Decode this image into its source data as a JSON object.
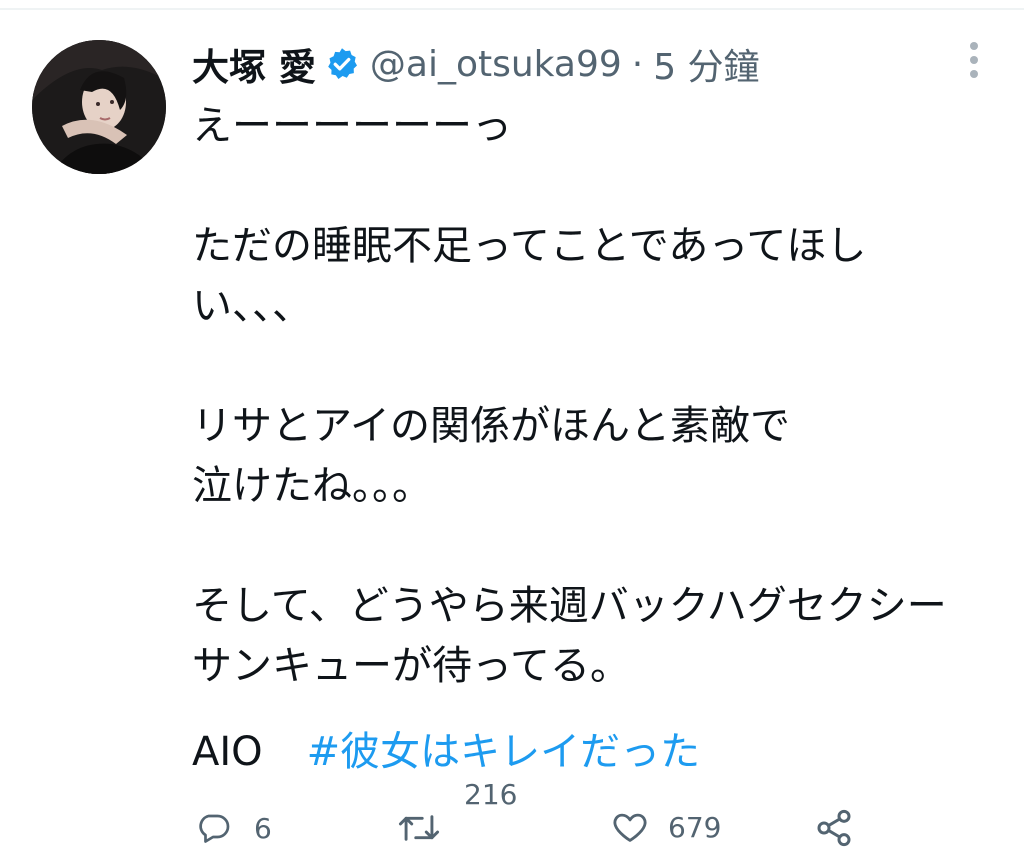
{
  "tweet": {
    "author": {
      "display_name": "大塚 愛",
      "handle": "@ai_otsuka99",
      "separator": "·",
      "time": "5 分鐘",
      "verified": true
    },
    "lines": [
      "えーーーーーーっ",
      "",
      "ただの睡眠不足ってことであってほし",
      "い、、、",
      "",
      "リサとアイの関係がほんと素敵で",
      "泣けたね。。。",
      "",
      "そして、どうやら来週バックハグセクシー",
      "サンキューが待ってる。"
    ],
    "footer_text": "AIO",
    "hashtag": "#彼女はキレイだった"
  },
  "actions": {
    "reply_count": "6",
    "retweet_count": "216",
    "like_count": "679"
  },
  "icons": {
    "verified": "verified-badge-icon",
    "more": "more-vertical-icon",
    "reply": "reply-bubble-icon",
    "retweet": "retweet-icon",
    "like": "heart-icon",
    "share": "share-icon"
  },
  "colors": {
    "link": "#1d9bf0",
    "muted": "#536471",
    "text": "#0f1419"
  }
}
